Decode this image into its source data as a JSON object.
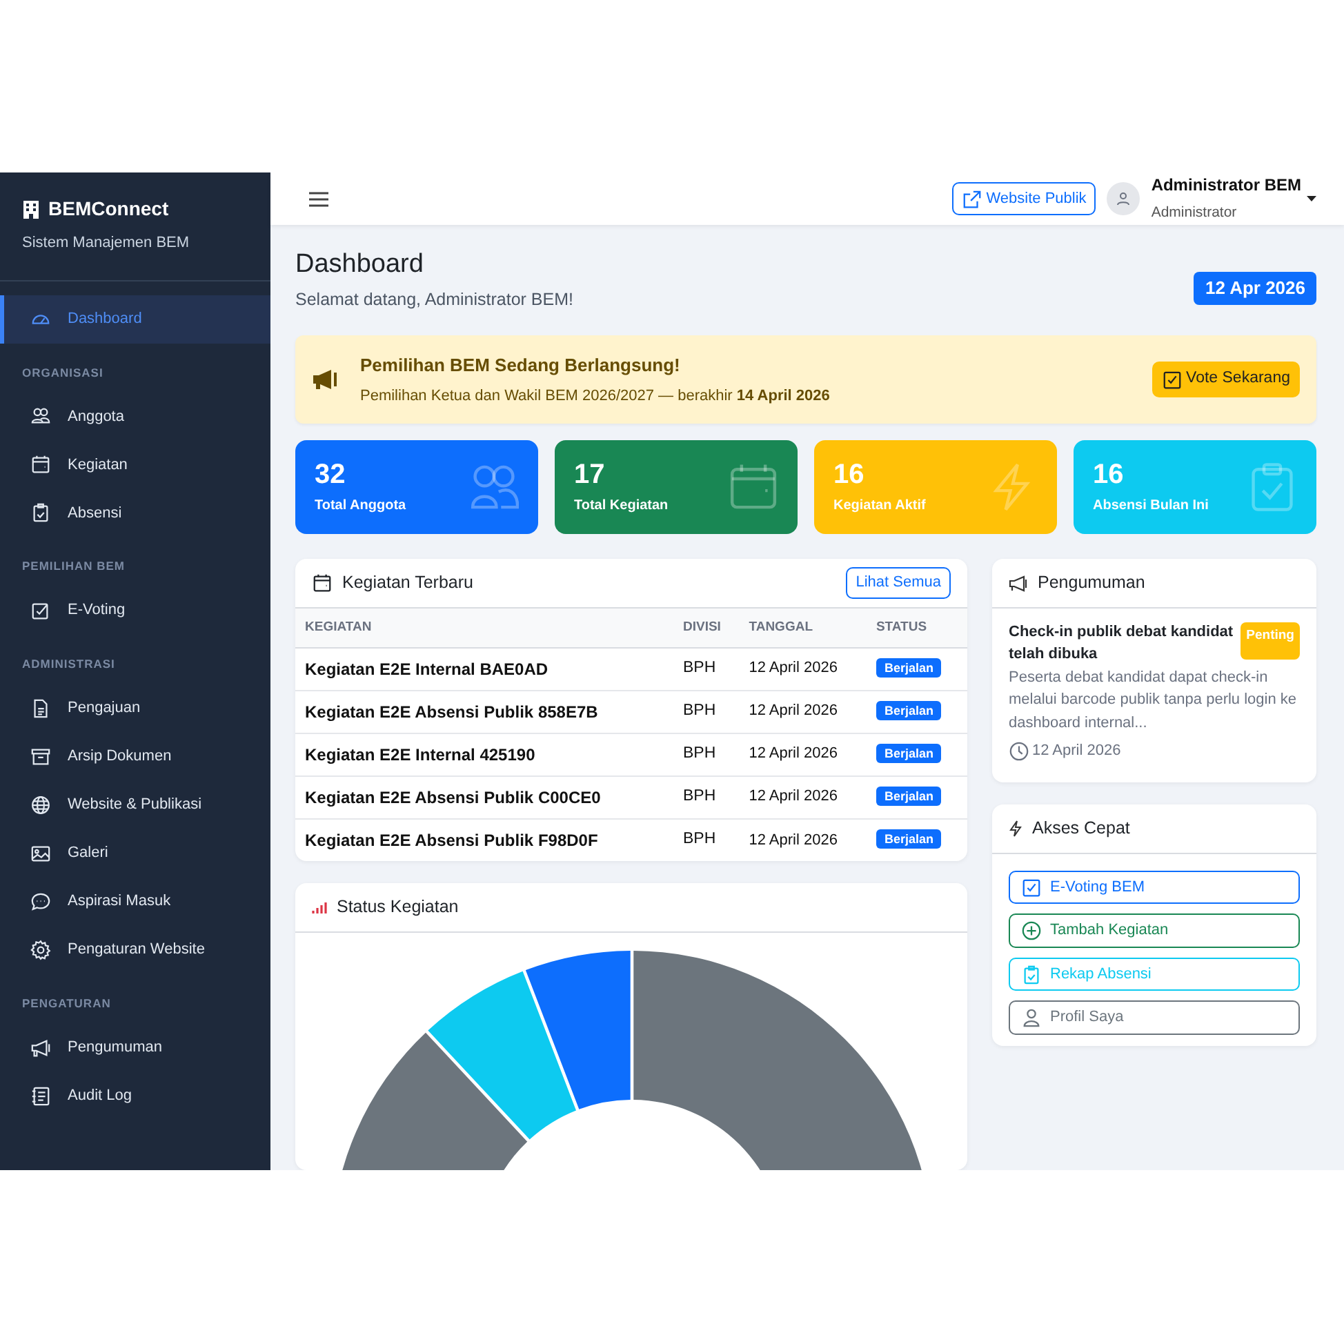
{
  "sidebar": {
    "brand": "BEMConnect",
    "subtitle": "Sistem Manajemen BEM",
    "items": [
      {
        "kind": "link",
        "label": "Dashboard",
        "selected": true
      },
      {
        "kind": "heading",
        "label": "ORGANISASI"
      },
      {
        "kind": "link",
        "label": "Anggota",
        "selected": false
      },
      {
        "kind": "link",
        "label": "Kegiatan",
        "selected": false
      },
      {
        "kind": "link",
        "label": "Absensi",
        "selected": false
      },
      {
        "kind": "heading",
        "label": "PEMILIHAN BEM"
      },
      {
        "kind": "link",
        "label": "E-Voting",
        "selected": false
      },
      {
        "kind": "heading",
        "label": "ADMINISTRASI"
      },
      {
        "kind": "link",
        "label": "Pengajuan",
        "selected": false
      },
      {
        "kind": "link",
        "label": "Arsip Dokumen",
        "selected": false
      },
      {
        "kind": "link",
        "label": "Website & Publikasi",
        "selected": false
      },
      {
        "kind": "link",
        "label": "Galeri",
        "selected": false
      },
      {
        "kind": "link",
        "label": "Aspirasi Masuk",
        "selected": false
      },
      {
        "kind": "link",
        "label": "Pengaturan Website",
        "selected": false
      },
      {
        "kind": "heading",
        "label": "PENGATURAN"
      },
      {
        "kind": "link",
        "label": "Pengumuman",
        "selected": false
      },
      {
        "kind": "link",
        "label": "Audit Log",
        "selected": false
      }
    ]
  },
  "topbar": {
    "website_button": "Website Publik",
    "user_name": "Administrator BEM",
    "user_role": "Administrator"
  },
  "page": {
    "title": "Dashboard",
    "welcome": "Selamat datang, Administrator BEM!",
    "date_badge": "12 Apr 2026"
  },
  "alert": {
    "title": "Pemilihan BEM Sedang Berlangsung!",
    "text": "Pemilihan Ketua dan Wakil BEM 2026/2027 — berakhir **14 April 2026**",
    "button": "Vote Sekarang"
  },
  "stats": [
    {
      "value": "32",
      "label": "Total Anggota",
      "color": "#0d6efd"
    },
    {
      "value": "17",
      "label": "Total Kegiatan",
      "color": "#198754"
    },
    {
      "value": "16",
      "label": "Kegiatan Aktif",
      "color": "#ffc107"
    },
    {
      "value": "16",
      "label": "Absensi Bulan Ini",
      "color": "#0dcaf0"
    }
  ],
  "recent_activities": {
    "title": "Kegiatan Terbaru",
    "button": "Lihat Semua",
    "columns": [
      "KEGIATAN",
      "DIVISI",
      "TANGGAL",
      "STATUS"
    ],
    "rows": [
      {
        "name": "Kegiatan E2E Internal BAE0AD",
        "division": "BPH",
        "date": "12 April 2026",
        "status": "Berjalan"
      },
      {
        "name": "Kegiatan E2E Absensi Publik 858E7B",
        "division": "BPH",
        "date": "12 April 2026",
        "status": "Berjalan"
      },
      {
        "name": "Kegiatan E2E Internal 425190",
        "division": "BPH",
        "date": "12 April 2026",
        "status": "Berjalan"
      },
      {
        "name": "Kegiatan E2E Absensi Publik C00CE0",
        "division": "BPH",
        "date": "12 April 2026",
        "status": "Berjalan"
      },
      {
        "name": "Kegiatan E2E Absensi Publik F98D0F",
        "division": "BPH",
        "date": "12 April 2026",
        "status": "Berjalan"
      }
    ]
  },
  "status_chart": {
    "title": "Status Kegiatan"
  },
  "announcements": {
    "title": "Pengumuman",
    "items": [
      {
        "title": "Check-in publik debat kandidat telah dibuka",
        "badge": "Penting",
        "text": "Peserta debat kandidat dapat check-in melalui barcode publik tanpa perlu login ke dashboard internal...",
        "date": "12 April 2026"
      }
    ]
  },
  "quick_access": {
    "title": "Akses Cepat",
    "links": [
      {
        "label": "E-Voting BEM",
        "color": "#0d6efd"
      },
      {
        "label": "Tambah Kegiatan",
        "color": "#198754"
      },
      {
        "label": "Rekap Absensi",
        "color": "#0dcaf0"
      },
      {
        "label": "Profil Saya",
        "color": "#6c757d"
      }
    ]
  }
}
